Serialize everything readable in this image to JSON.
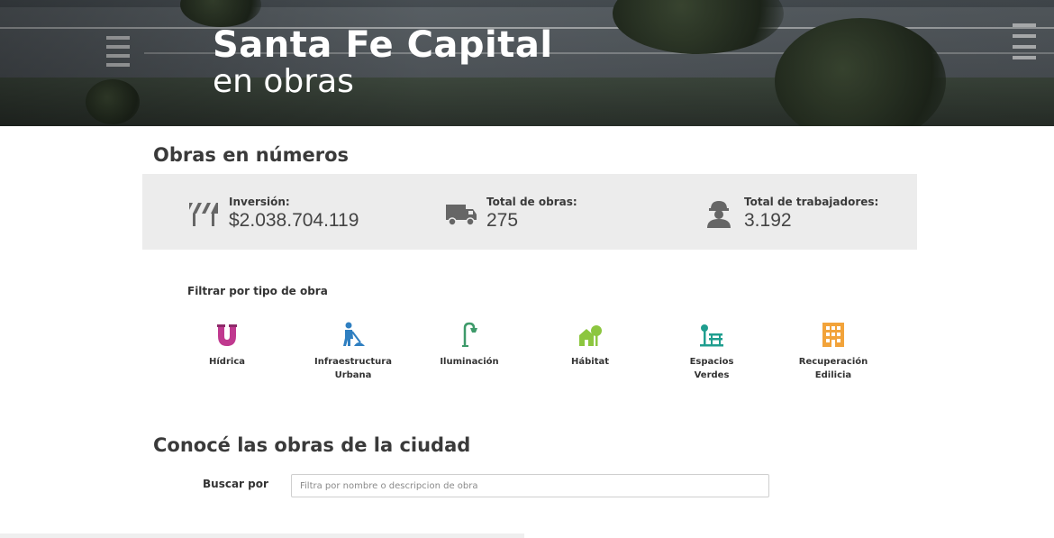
{
  "hero": {
    "title": "Santa Fe Capital",
    "subtitle": "en obras"
  },
  "numbers_section": {
    "title": "Obras en números",
    "stats": [
      {
        "icon": "road-barrier-icon",
        "label": "Inversión:",
        "value": "$2.038.704.119"
      },
      {
        "icon": "truck-icon",
        "label": "Total de obras:",
        "value": "275"
      },
      {
        "icon": "construction-worker-icon",
        "label": "Total de trabajadores:",
        "value": "3.192"
      }
    ]
  },
  "filter": {
    "title": "Filtrar por tipo de obra",
    "categories": [
      {
        "label": "Hídrica",
        "icon": "pipe-icon",
        "color": "#c0398f"
      },
      {
        "label": "Infraestructura\nUrbana",
        "icon": "road-worker-icon",
        "color": "#2f7fc1"
      },
      {
        "label": "Iluminación",
        "icon": "street-lamp-icon",
        "color": "#3e9a6a"
      },
      {
        "label": "Hábitat",
        "icon": "house-tree-icon",
        "color": "#8cc63f"
      },
      {
        "label": "Espacios\nVerdes",
        "icon": "park-bench-icon",
        "color": "#1f9e8f"
      },
      {
        "label": "Recuperación\nEdilicia",
        "icon": "building-icon",
        "color": "#f2a33a"
      }
    ]
  },
  "search_section": {
    "title": "Conocé las obras de la ciudad",
    "label": "Buscar por",
    "placeholder": "Filtra por nombre o descripcion de obra"
  }
}
